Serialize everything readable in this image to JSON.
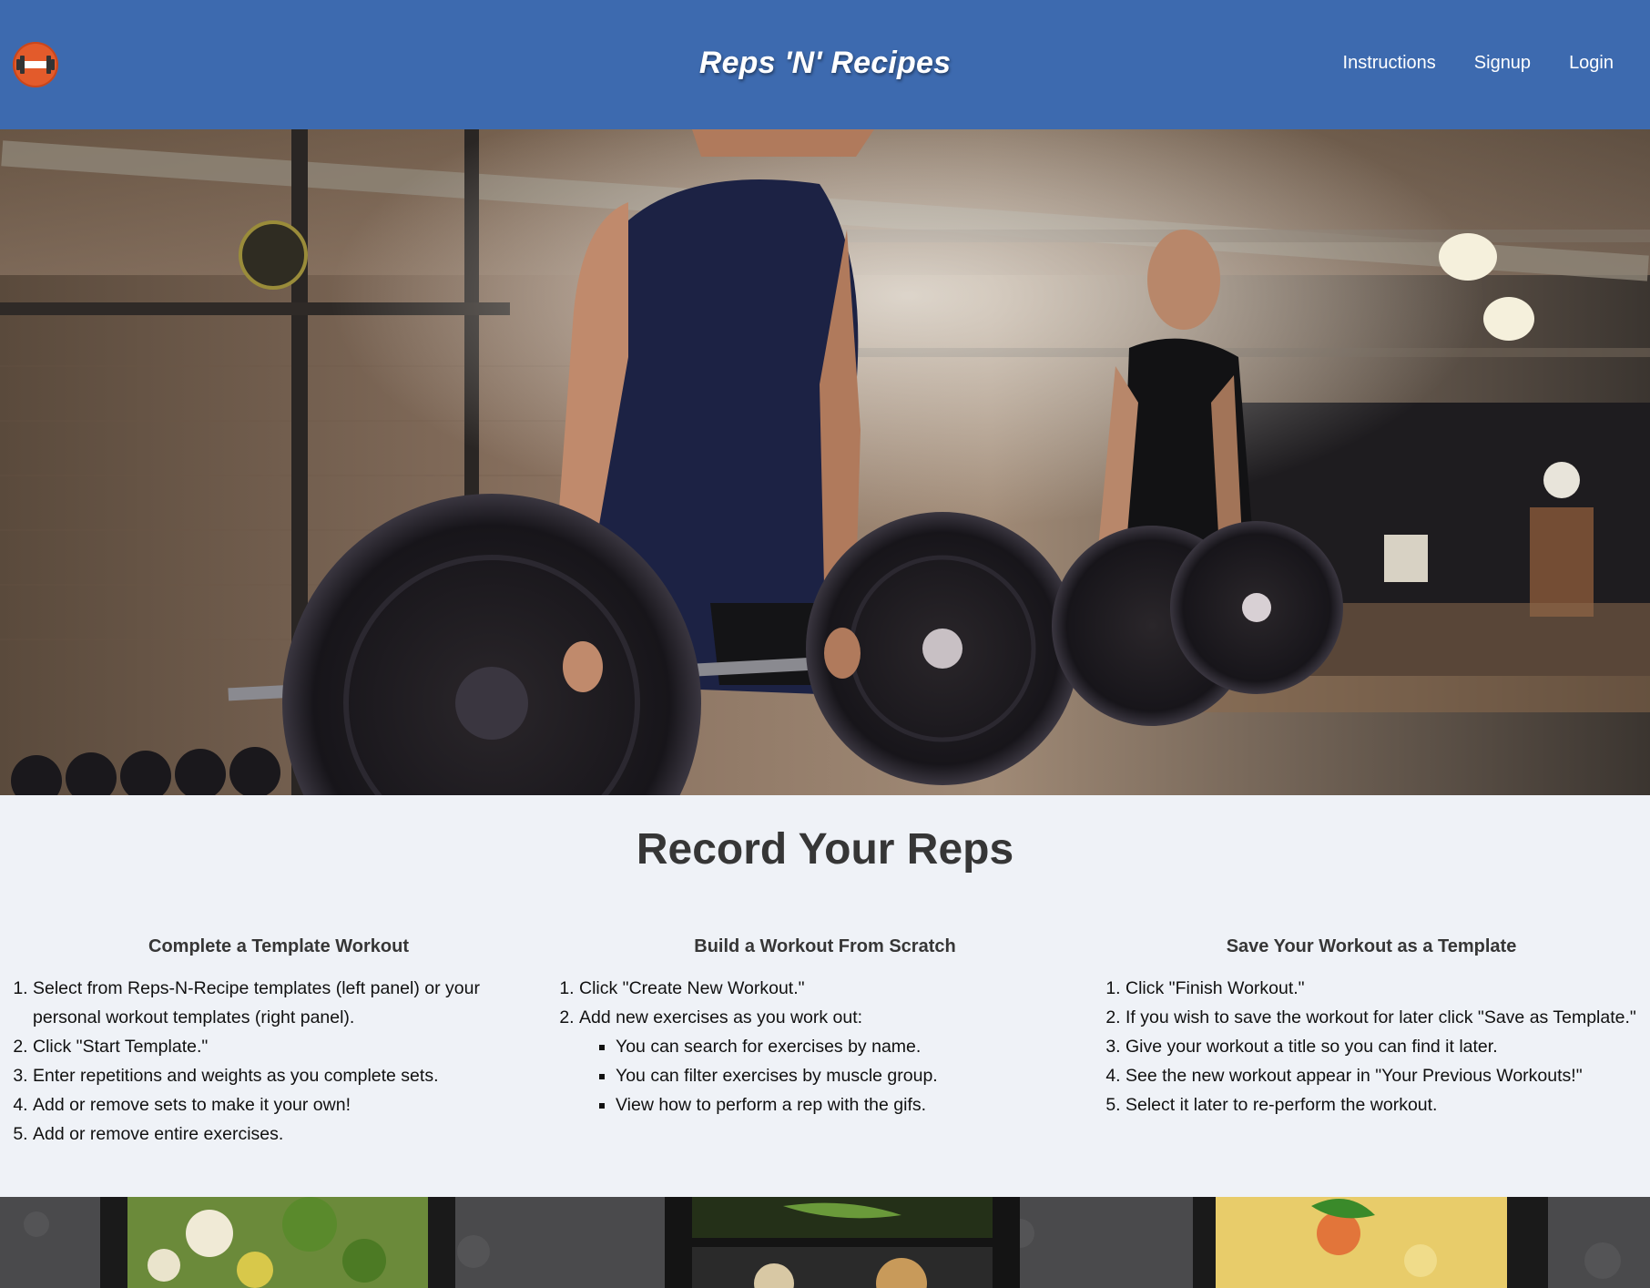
{
  "navbar": {
    "logo_icon": "dumbbell-icon",
    "brand": "Reps 'N' Recipes",
    "links": [
      {
        "label": "Instructions"
      },
      {
        "label": "Signup"
      },
      {
        "label": "Login"
      }
    ]
  },
  "colors": {
    "navbar": "#3d6aaf",
    "logo": "#e35b2b",
    "page_background": "#eff2f7",
    "heading_text": "#363636"
  },
  "instructions": {
    "title": "Record Your Reps",
    "columns": [
      {
        "title": "Complete a Template Workout",
        "steps": [
          "Select from Reps-N-Recipe templates (left panel) or your personal workout templates (right panel).",
          "Click \"Start Template.\"",
          "Enter repetitions and weights as you complete sets.",
          "Add or remove sets to make it your own!",
          "Add or remove entire exercises."
        ]
      },
      {
        "title": "Build a Workout From Scratch",
        "steps": [
          "Click \"Create New Workout.\"",
          "Add new exercises as you work out:"
        ],
        "substeps": [
          "You can search for exercises by name.",
          "You can filter exercises by muscle group.",
          "View how to perform a rep with the gifs."
        ]
      },
      {
        "title": "Save Your Workout as a Template",
        "steps": [
          "Click \"Finish Workout.\"",
          "If you wish to save the workout for later click \"Save as Template.\"",
          "Give your workout a title so you can find it later.",
          "See the new workout appear in \"Your Previous Workouts!\"",
          "Select it later to re-perform the workout."
        ]
      }
    ]
  }
}
